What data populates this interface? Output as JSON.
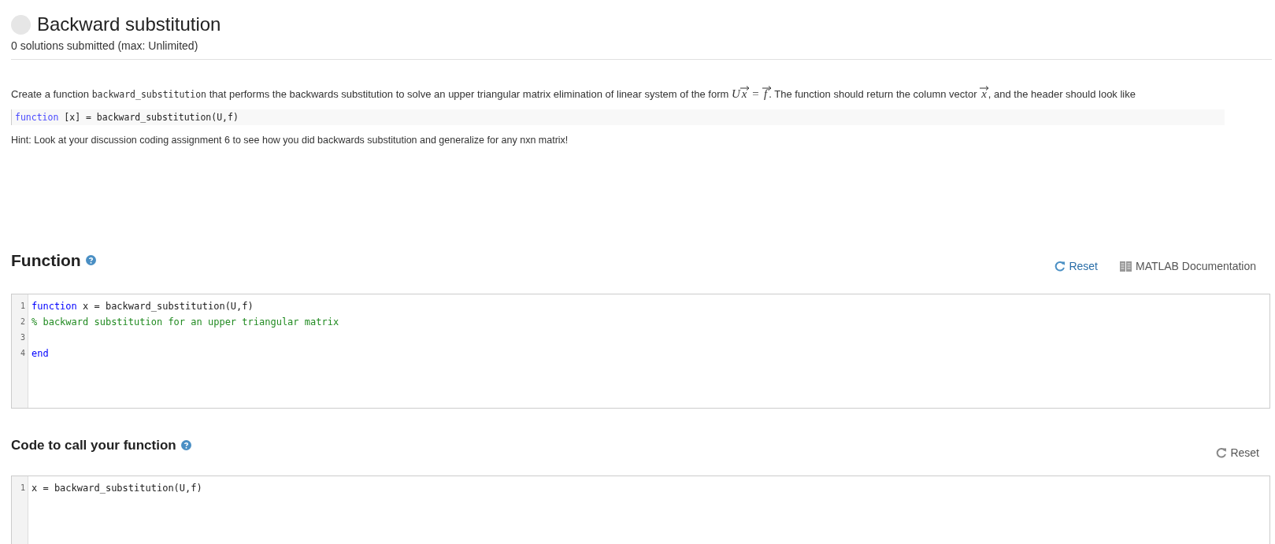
{
  "problem": {
    "title": "Backward substitution",
    "solved": false,
    "submissions": "0 solutions submitted (max: Unlimited)"
  },
  "description": [
    {
      "kind": "text",
      "text": "Create a function "
    },
    {
      "kind": "code",
      "text": "backward_substitution"
    },
    {
      "kind": "text",
      "text": " that performs the backwards substitution to solve an upper triangular matrix elimination of linear system of the form "
    },
    {
      "kind": "math",
      "text": "U"
    },
    {
      "kind": "vec",
      "text": "x"
    },
    {
      "kind": "math",
      "text": " = "
    },
    {
      "kind": "vec",
      "text": "f"
    },
    {
      "kind": "text",
      "text": ". The function should return the column vector "
    },
    {
      "kind": "vec",
      "text": "x"
    },
    {
      "kind": "text",
      "text": ", and the header should look like"
    }
  ],
  "header_snippet": [
    {
      "kind": "keyword",
      "text": "function"
    },
    {
      "kind": "plain",
      "text": " [x] = backward_substitution(U,f)"
    }
  ],
  "hint": "Hint: Look at your discussion coding assignment 6 to see how you did backwards substitution and generalize for any nxn matrix!",
  "sections": [
    {
      "heading": "Function",
      "actions": [
        {
          "kind": "reset",
          "label": "Reset"
        },
        {
          "kind": "docs",
          "label": "MATLAB Documentation"
        }
      ],
      "lines": [
        {
          "number": "1",
          "tokens": [
            {
              "kind": "keyword",
              "text": "function"
            },
            {
              "kind": "plain",
              "text": " x = backward_substitution(U,f)"
            }
          ]
        },
        {
          "number": "2",
          "tokens": [
            {
              "kind": "comment",
              "text": "% backward substitution for an upper triangular matrix"
            }
          ]
        },
        {
          "number": "3"
        },
        {
          "number": "4",
          "tokens": [
            {
              "kind": "keyword",
              "text": "end"
            }
          ]
        }
      ]
    },
    {
      "heading": "Code to call your function",
      "actions": [
        {
          "kind": "reset_muted",
          "label": "Reset"
        }
      ],
      "lines": [
        {
          "number": "1",
          "tokens": [
            {
              "kind": "plain",
              "text": "x = backward_substitution(U,f)"
            }
          ]
        }
      ]
    }
  ]
}
